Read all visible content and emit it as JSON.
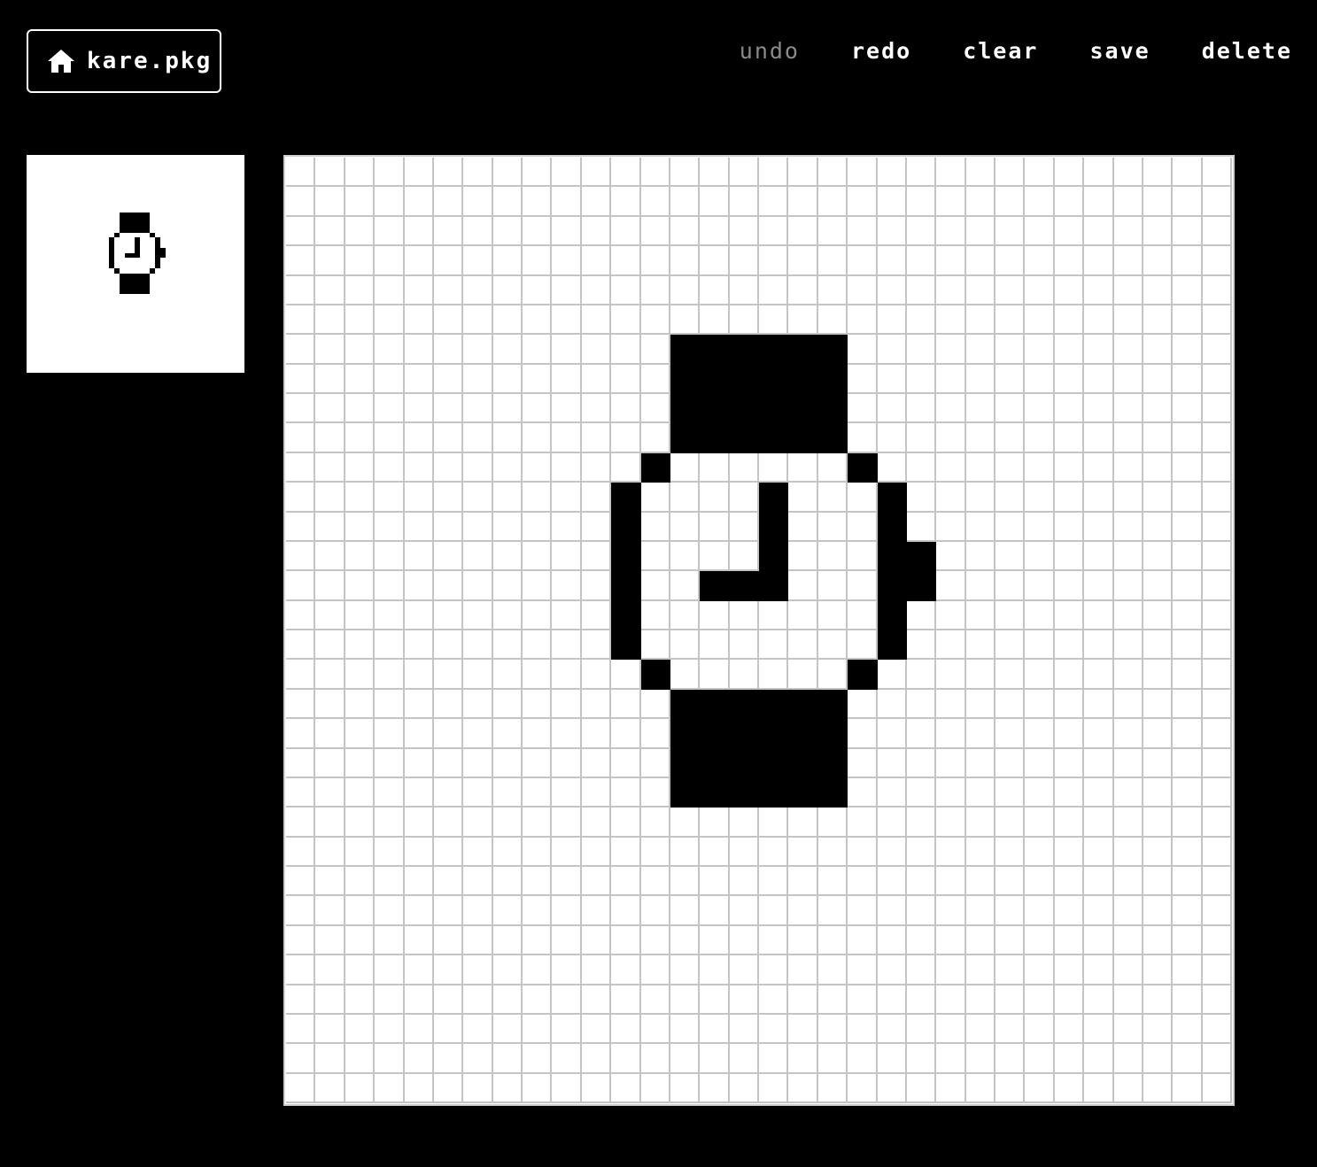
{
  "header": {
    "home_label": "kare.pkg",
    "home_icon": "home-icon"
  },
  "toolbar": {
    "items": [
      {
        "label": "undo",
        "enabled": false
      },
      {
        "label": "redo",
        "enabled": true
      },
      {
        "label": "clear",
        "enabled": true
      },
      {
        "label": "save",
        "enabled": true
      },
      {
        "label": "delete",
        "enabled": true
      }
    ]
  },
  "canvas": {
    "grid_size": 32,
    "filled_color": "#000000",
    "empty_color": "#ffffff",
    "grid_line_color": "#c4c4c4",
    "pixels": [
      "................................",
      "................................",
      "................................",
      "................................",
      "................................",
      "................................",
      ".............######.............",
      ".............######.............",
      ".............######.............",
      ".............######.............",
      "............#......#............",
      "...........#....#...#...........",
      "...........#....#...#...........",
      "...........#....#...##..........",
      "...........#..###...##..........",
      "...........#........#...........",
      "...........#........#...........",
      "............#......#............",
      ".............######.............",
      ".............######.............",
      ".............######.............",
      ".............######.............",
      "................................",
      "................................",
      "................................",
      "................................",
      "................................",
      "................................",
      "................................",
      "................................",
      "................................",
      "................................"
    ]
  }
}
